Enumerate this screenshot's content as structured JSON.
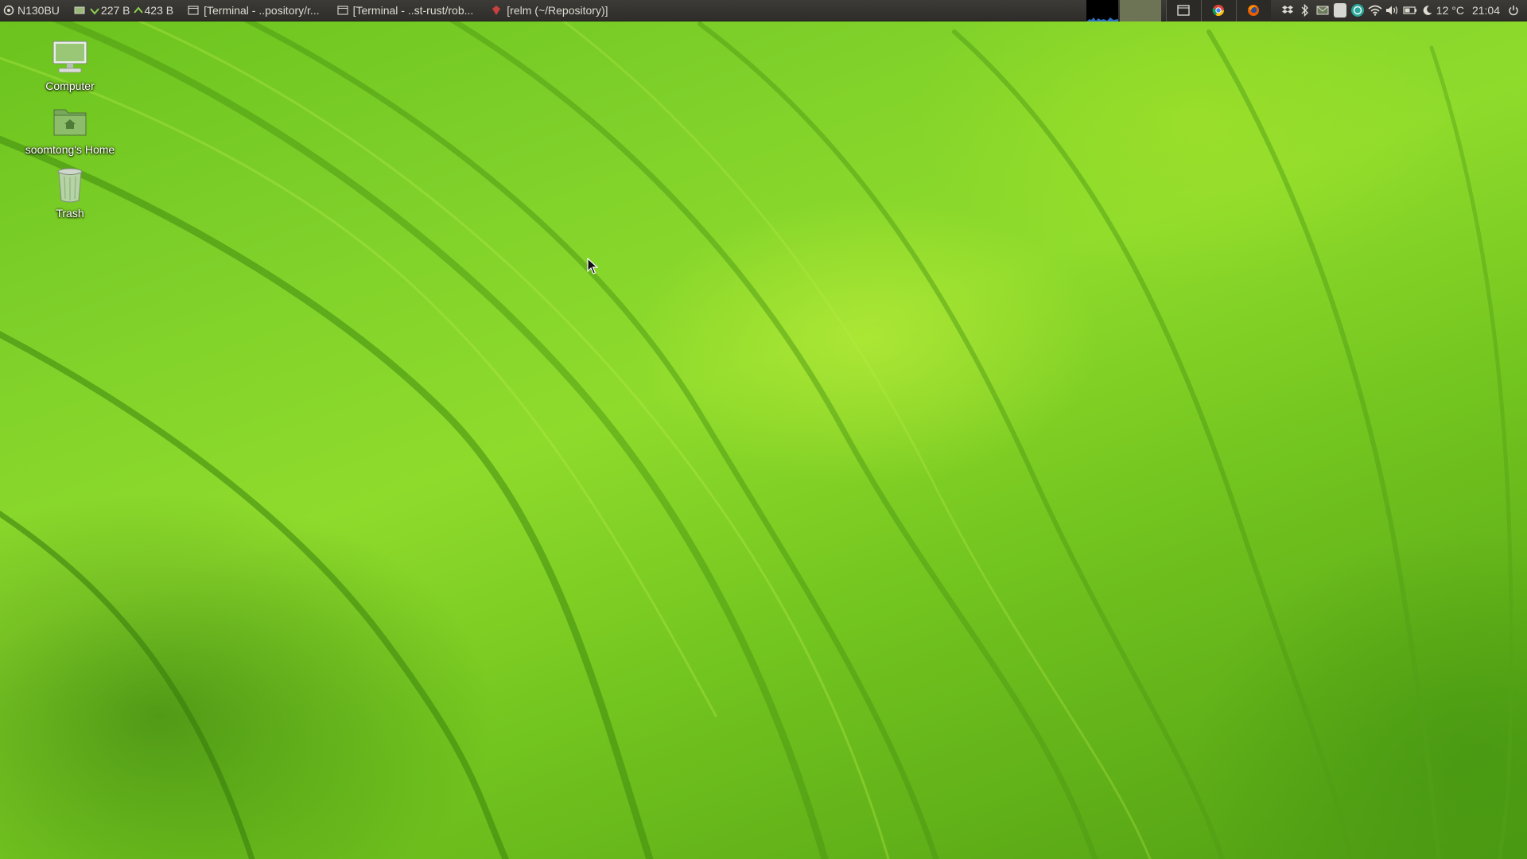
{
  "panel": {
    "hostname": "N130BU",
    "net_down": "227 B",
    "net_up": "423 B",
    "tasks": [
      {
        "label": "[Terminal - ..pository/r..."
      },
      {
        "label": "[Terminal - ..st-rust/rob..."
      },
      {
        "label": "[relm (~/Repository)]"
      }
    ],
    "temperature": "12 °C",
    "clock": "21:04"
  },
  "desktop": {
    "icons": [
      {
        "label": "Computer",
        "icon": "computer-icon"
      },
      {
        "label": "soomtong's Home",
        "icon": "home-folder-icon"
      },
      {
        "label": "Trash",
        "icon": "trash-icon"
      }
    ]
  },
  "colors": {
    "panel_bg": "#3c3b37",
    "wallpaper_green": "#7fd12a"
  }
}
